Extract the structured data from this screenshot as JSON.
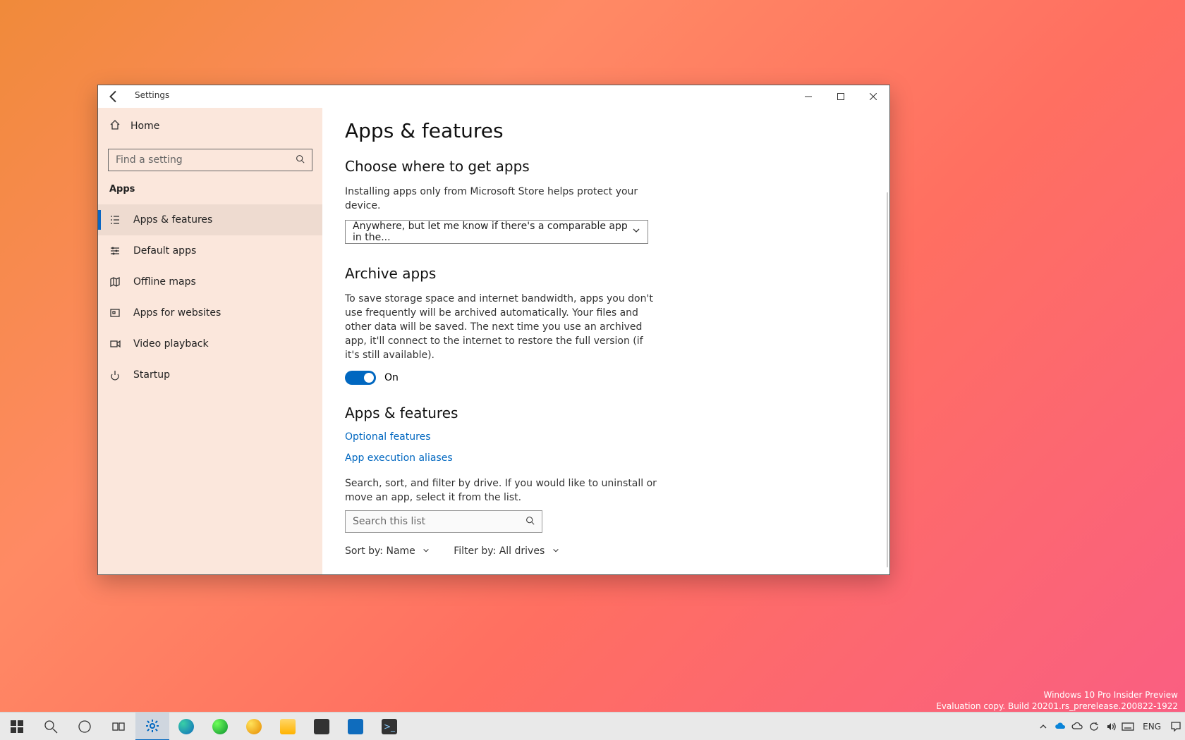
{
  "watermark": {
    "line1": "Windows 10 Pro Insider Preview",
    "line2": "Evaluation copy. Build 20201.rs_prerelease.200822-1922"
  },
  "window": {
    "title": "Settings",
    "sidebar": {
      "home": "Home",
      "search_placeholder": "Find a setting",
      "section": "Apps",
      "items": [
        {
          "icon": "list",
          "label": "Apps & features",
          "active": true
        },
        {
          "icon": "defaults",
          "label": "Default apps"
        },
        {
          "icon": "map",
          "label": "Offline maps"
        },
        {
          "icon": "box",
          "label": "Apps for websites"
        },
        {
          "icon": "video",
          "label": "Video playback"
        },
        {
          "icon": "startup",
          "label": "Startup"
        }
      ]
    },
    "content": {
      "page_title": "Apps & features",
      "section_where": {
        "heading": "Choose where to get apps",
        "desc": "Installing apps only from Microsoft Store helps protect your device.",
        "select_value": "Anywhere, but let me know if there's a comparable app in the..."
      },
      "section_archive": {
        "heading": "Archive apps",
        "desc": "To save storage space and internet bandwidth, apps you don't use frequently will be archived automatically. Your files and other data will be saved. The next time you use an archived app, it'll connect to the internet to restore the full version (if it's still available).",
        "toggle_state": "On"
      },
      "section_apps": {
        "heading": "Apps & features",
        "link_optional": "Optional features",
        "link_aliases": "App execution aliases",
        "desc": "Search, sort, and filter by drive. If you would like to uninstall or move an app, select it from the list.",
        "search_placeholder": "Search this list",
        "sort_label": "Sort by:",
        "sort_value": "Name",
        "filter_label": "Filter by:",
        "filter_value": "All drives"
      }
    }
  },
  "taskbar": {
    "apps": [
      "start",
      "search",
      "cortana",
      "taskview",
      "settings",
      "edge",
      "edge-dev",
      "edge-canary",
      "explorer",
      "store",
      "mail",
      "terminal"
    ],
    "active": "settings",
    "tray": {
      "lang": "ENG"
    }
  }
}
